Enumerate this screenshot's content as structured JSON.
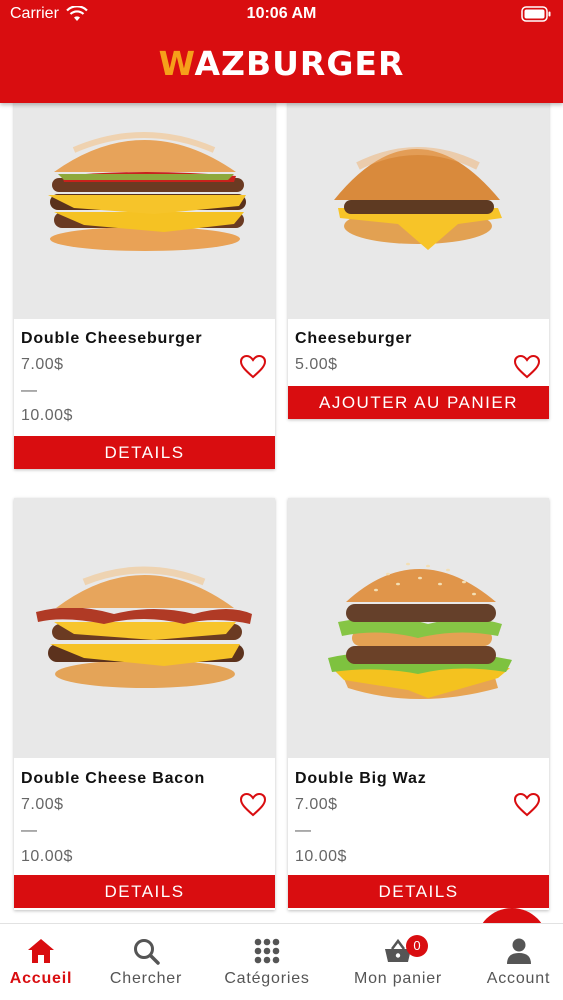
{
  "status_bar": {
    "carrier": "Carrier",
    "time": "10:06 AM"
  },
  "header": {
    "logo_first": "W",
    "logo_rest": "AZBURGER",
    "brand_color": "#d90d10",
    "logo_accent": "#f6a01a"
  },
  "products": [
    {
      "name": "Double Cheeseburger",
      "price": "7.00$",
      "separator": "—",
      "price2": "10.00$",
      "button": "DETAILS",
      "favorite_icon": "heart-outline-icon"
    },
    {
      "name": "Cheeseburger",
      "price": "5.00$",
      "button": "AJOUTER AU PANIER",
      "favorite_icon": "heart-outline-icon"
    },
    {
      "name": "Double Cheese Bacon",
      "price": "7.00$",
      "separator": "—",
      "price2": "10.00$",
      "button": "DETAILS",
      "favorite_icon": "heart-outline-icon"
    },
    {
      "name": "Double Big Waz",
      "price": "7.00$",
      "separator": "—",
      "price2": "10.00$",
      "button": "DETAILS",
      "favorite_icon": "heart-outline-icon"
    }
  ],
  "tabbar": {
    "tabs": [
      {
        "label": "Accueil",
        "icon": "home-icon",
        "active": true
      },
      {
        "label": "Chercher",
        "icon": "search-icon",
        "active": false
      },
      {
        "label": "Catégories",
        "icon": "grid-icon",
        "active": false
      },
      {
        "label": "Mon panier",
        "icon": "basket-icon",
        "active": false,
        "badge": "0"
      },
      {
        "label": "Account",
        "icon": "user-icon",
        "active": false
      }
    ]
  }
}
